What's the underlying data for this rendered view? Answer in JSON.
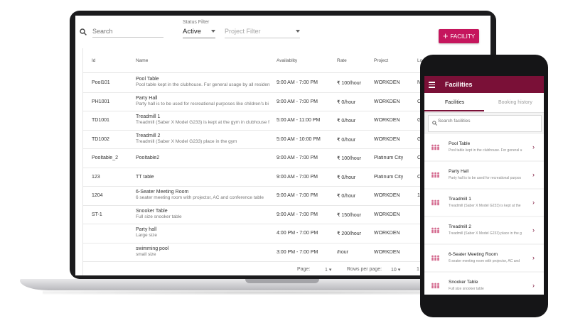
{
  "toolbar": {
    "search_placeholder": "Search",
    "status_caption": "Status Filter",
    "status_value": "Active",
    "project_placeholder": "Project Filter",
    "add_button_label": "FACILITY"
  },
  "table": {
    "headers": [
      "Id",
      "Name",
      "Availablity",
      "Rate",
      "Project",
      "Lo"
    ],
    "rows": [
      {
        "id": "Pool101",
        "name": "Pool Table",
        "desc": "Pool table kept in the clubhouse. For general usage by all residen",
        "availability": "9:00 AM - 7:00 PM",
        "rate": "₹ 100/hour",
        "project": "WORKDEN",
        "loc": "N"
      },
      {
        "id": "PH1001",
        "name": "Party Hall",
        "desc": "Party hall is to be used for recreational purposes like children's bi",
        "availability": "9:00 AM - 7:00 PM",
        "rate": "₹ 0/hour",
        "project": "WORKDEN",
        "loc": "C"
      },
      {
        "id": "TD1001",
        "name": "Treadmill 1",
        "desc": "Treadmill (Saber X Model G233) is kept at the gym in clubhouse f",
        "availability": "5:00 AM - 11:00 PM",
        "rate": "₹ 0/hour",
        "project": "WORKDEN",
        "loc": "G"
      },
      {
        "id": "TD1002",
        "name": "Treadmill 2",
        "desc": "Treadmill (Saber X Model G233) place in the gym",
        "availability": "5:00 AM - 10:00 PM",
        "rate": "₹ 0/hour",
        "project": "WORKDEN",
        "loc": "G"
      },
      {
        "id": "Pooltable_2",
        "name": "Pooltable2",
        "desc": "",
        "availability": "9:00 AM - 7:00 PM",
        "rate": "₹ 100/hour",
        "project": "Platinum City",
        "loc": "C"
      },
      {
        "id": "123",
        "name": "TT table",
        "desc": "",
        "availability": "9:00 AM - 7:00 PM",
        "rate": "₹ 0/hour",
        "project": "Platinum City",
        "loc": "C"
      },
      {
        "id": "1204",
        "name": "6-Seater Meeting Room",
        "desc": "6 seater meeting room with projector, AC and conference table",
        "availability": "9:00 AM - 7:00 PM",
        "rate": "₹ 0/hour",
        "project": "WORKDEN",
        "loc": "1"
      },
      {
        "id": "ST-1",
        "name": "Snooker Table",
        "desc": "Full size snooker table",
        "availability": "9:00 AM - 7:00 PM",
        "rate": "₹ 150/hour",
        "project": "WORKDEN",
        "loc": ""
      },
      {
        "id": "",
        "name": "Party hall",
        "desc": "Large size",
        "availability": "4:00 PM - 7:00 PM",
        "rate": "₹ 200/hour",
        "project": "WORKDEN",
        "loc": ""
      },
      {
        "id": "",
        "name": "swimming pool",
        "desc": "small size",
        "availability": "3:00 PM - 7:00 PM",
        "rate": "/hour",
        "project": "WORKDEN",
        "loc": ""
      }
    ]
  },
  "footer": {
    "page_label": "Page:",
    "page_value": "1",
    "rows_label": "Rows per page:",
    "rows_value": "10",
    "range_text": "1"
  },
  "phone": {
    "title": "Facilities",
    "tabs": [
      "Facilities",
      "Booking history"
    ],
    "search_placeholder": "Search facilities",
    "items": [
      {
        "title": "Pool Table",
        "subtitle": "Pool table kept in the clubhouse. For general u"
      },
      {
        "title": "Party Hall",
        "subtitle": "Party hall is to be used for recreational purpos"
      },
      {
        "title": "Treadmill 1",
        "subtitle": "Treadmill (Saber X Model G233) is kept at the"
      },
      {
        "title": "Treadmill 2",
        "subtitle": "Treadmill (Saber X Model G233) place in the g"
      },
      {
        "title": "6-Seater Meeting Room",
        "subtitle": "6 seater meeting room with projector, AC and"
      },
      {
        "title": "Snooker Table",
        "subtitle": "Full size snooker table"
      }
    ]
  },
  "colors": {
    "accent": "#c5165d",
    "appbar": "#7a1037"
  }
}
